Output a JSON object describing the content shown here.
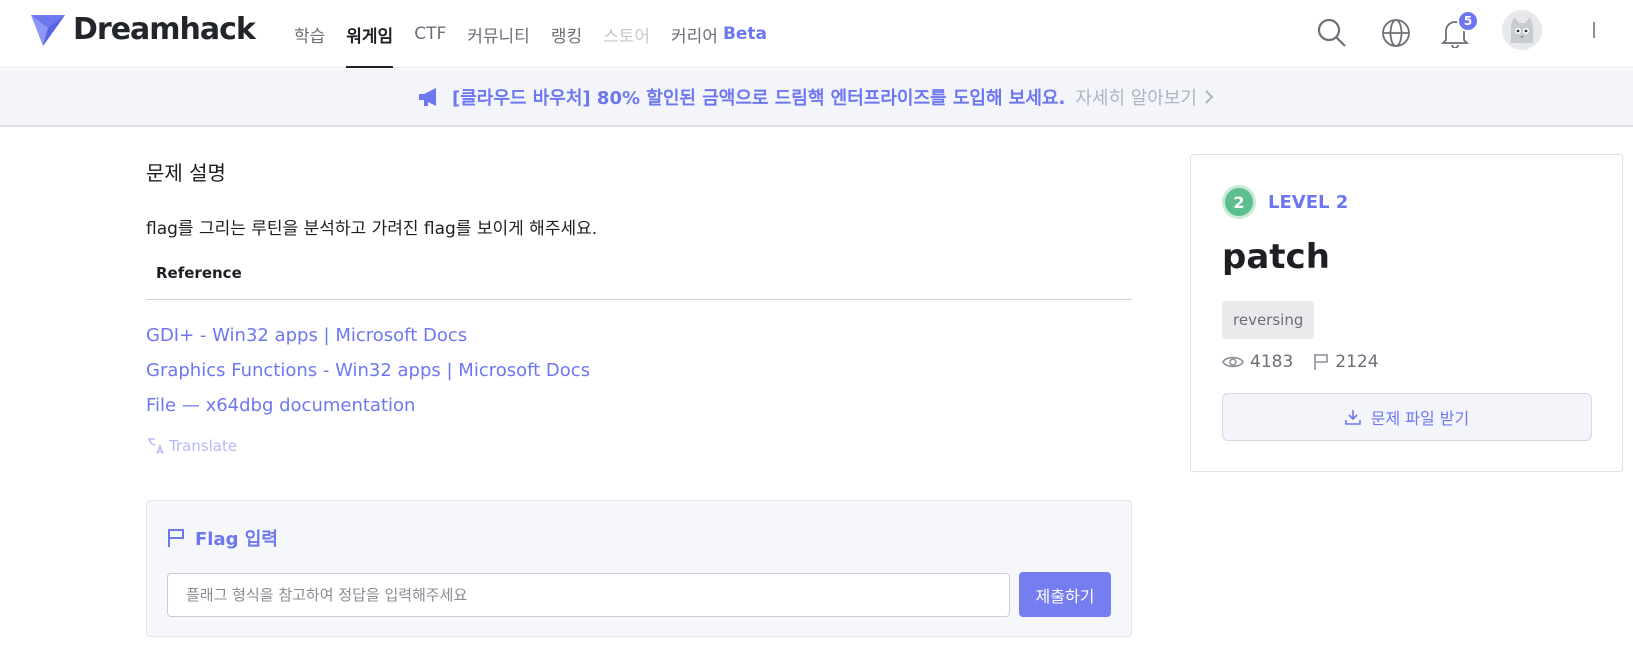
{
  "brand": {
    "name": "Dreamhack",
    "accent": "#6d78f0",
    "level_color": "#5cbf8d"
  },
  "nav": {
    "items": [
      {
        "label": "학습"
      },
      {
        "label": "워게임"
      },
      {
        "label": "CTF"
      },
      {
        "label": "커뮤니티"
      },
      {
        "label": "랭킹"
      },
      {
        "label": "스토어"
      },
      {
        "label": "커리어",
        "suffix": "Beta"
      }
    ],
    "active_index": 1,
    "disabled_index": 5
  },
  "header": {
    "notification_count": "5"
  },
  "banner": {
    "text": "[클라우드 바우처] 80% 할인된 금액으로 드림핵 엔터프라이즈를 도입해 보세요.",
    "link": "자세히 알아보기"
  },
  "problem": {
    "section_title": "문제 설명",
    "description": "flag를 그리는 루틴을 분석하고 가려진 flag를 보이게 해주세요.",
    "reference_header": "Reference",
    "references": [
      "GDI+ - Win32 apps | Microsoft Docs",
      "Graphics Functions - Win32 apps | Microsoft Docs",
      "File — x64dbg documentation"
    ],
    "translate": "Translate"
  },
  "flag": {
    "title": "Flag 입력",
    "placeholder": "플래그 형식을 참고하여 정답을 입력해주세요",
    "value": "",
    "submit": "제출하기"
  },
  "challenge": {
    "level_number": "2",
    "level_label": "LEVEL 2",
    "title": "patch",
    "tag": "reversing",
    "views": "4183",
    "solves": "2124",
    "download": "문제 파일 받기"
  }
}
